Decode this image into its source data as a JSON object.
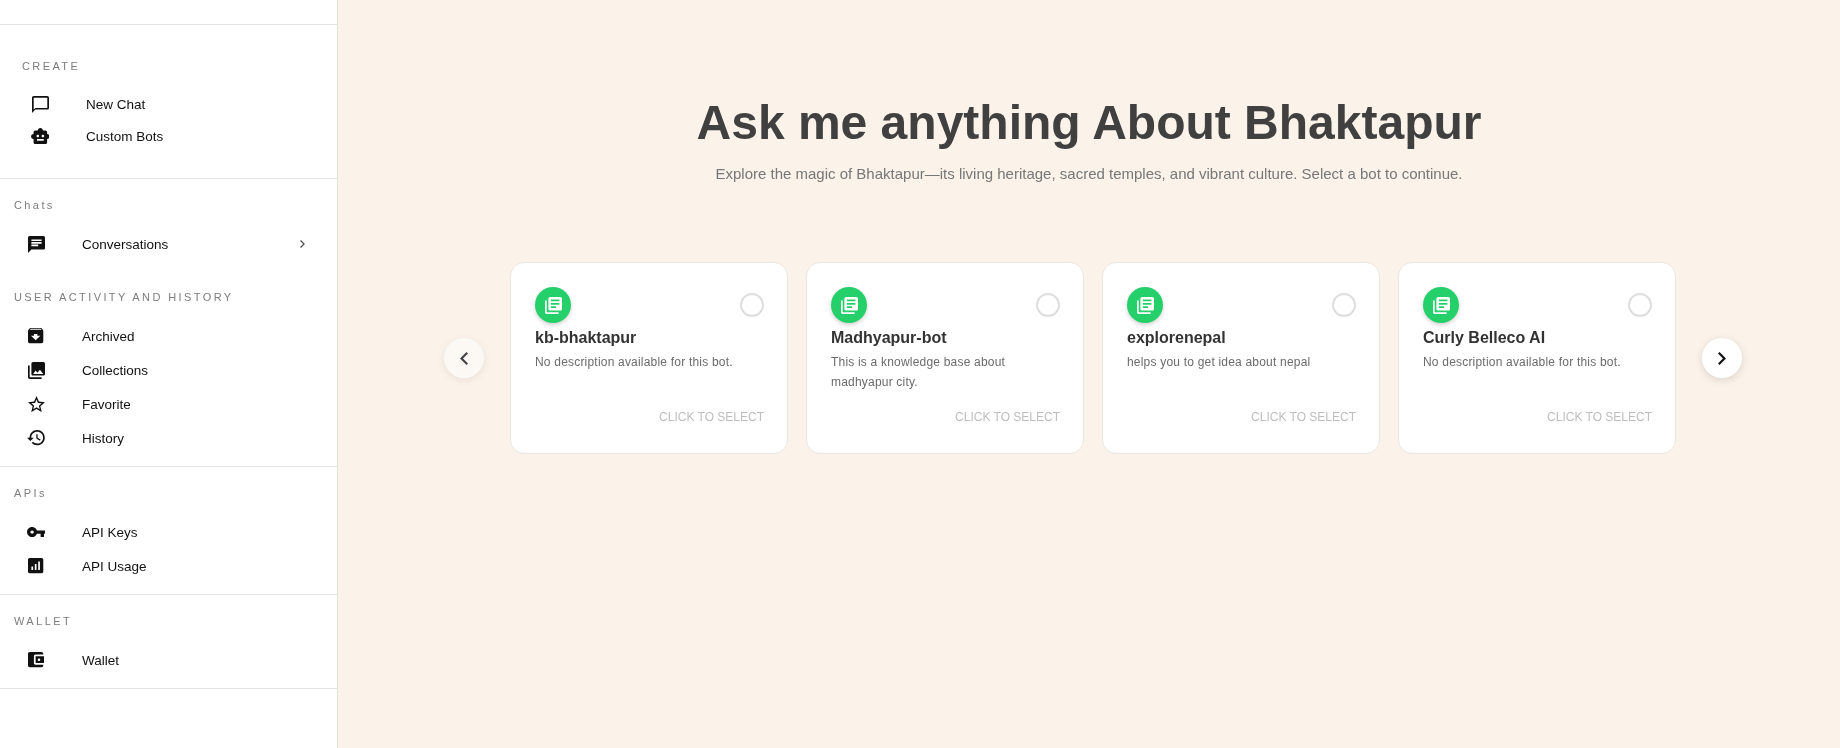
{
  "sidebar": {
    "groups": [
      {
        "sections": [
          {
            "heading": "CREATE",
            "items": [
              {
                "label": "New Chat",
                "kind": "link"
              },
              {
                "label": "Custom Bots",
                "kind": "link"
              }
            ]
          }
        ]
      },
      {
        "sections": [
          {
            "heading": "Chats",
            "items": [
              {
                "label": "Conversations",
                "kind": "submenu"
              }
            ]
          },
          {
            "heading": "USER ACTIVITY AND HISTORY",
            "items": [
              {
                "label": "Archived",
                "kind": "link"
              },
              {
                "label": "Collections",
                "kind": "link"
              },
              {
                "label": "Favorite",
                "kind": "link"
              },
              {
                "label": "History",
                "kind": "link"
              }
            ]
          }
        ]
      },
      {
        "sections": [
          {
            "heading": "APIs",
            "items": [
              {
                "label": "API Keys",
                "kind": "link"
              },
              {
                "label": "API Usage",
                "kind": "link"
              }
            ]
          }
        ]
      },
      {
        "sections": [
          {
            "heading": "WALLET",
            "items": [
              {
                "label": "Wallet",
                "kind": "link"
              }
            ]
          }
        ]
      }
    ]
  },
  "main": {
    "title": "Ask me anything About Bhaktapur",
    "subtitle": "Explore the magic of Bhaktapur—its living heritage, sacred temples, and vibrant culture. Select a bot to continue.",
    "carousel": {
      "prev_button": {
        "disabled": true
      },
      "next_button": {
        "disabled": false
      },
      "bots": [
        {
          "name": "kb-bhaktapur",
          "description": "No description available for this bot.",
          "action": "CLICK TO SELECT",
          "selected": false
        },
        {
          "name": "Madhyapur-bot",
          "description": "This is a knowledge base about madhyapur city.",
          "action": "CLICK TO SELECT",
          "selected": false
        },
        {
          "name": "explorenepal",
          "description": "helps you to get idea about nepal",
          "action": "CLICK TO SELECT",
          "selected": false
        },
        {
          "name": "Curly Belleco AI",
          "description": "No description available for this bot.",
          "action": "CLICK TO SELECT",
          "selected": false
        }
      ]
    }
  }
}
